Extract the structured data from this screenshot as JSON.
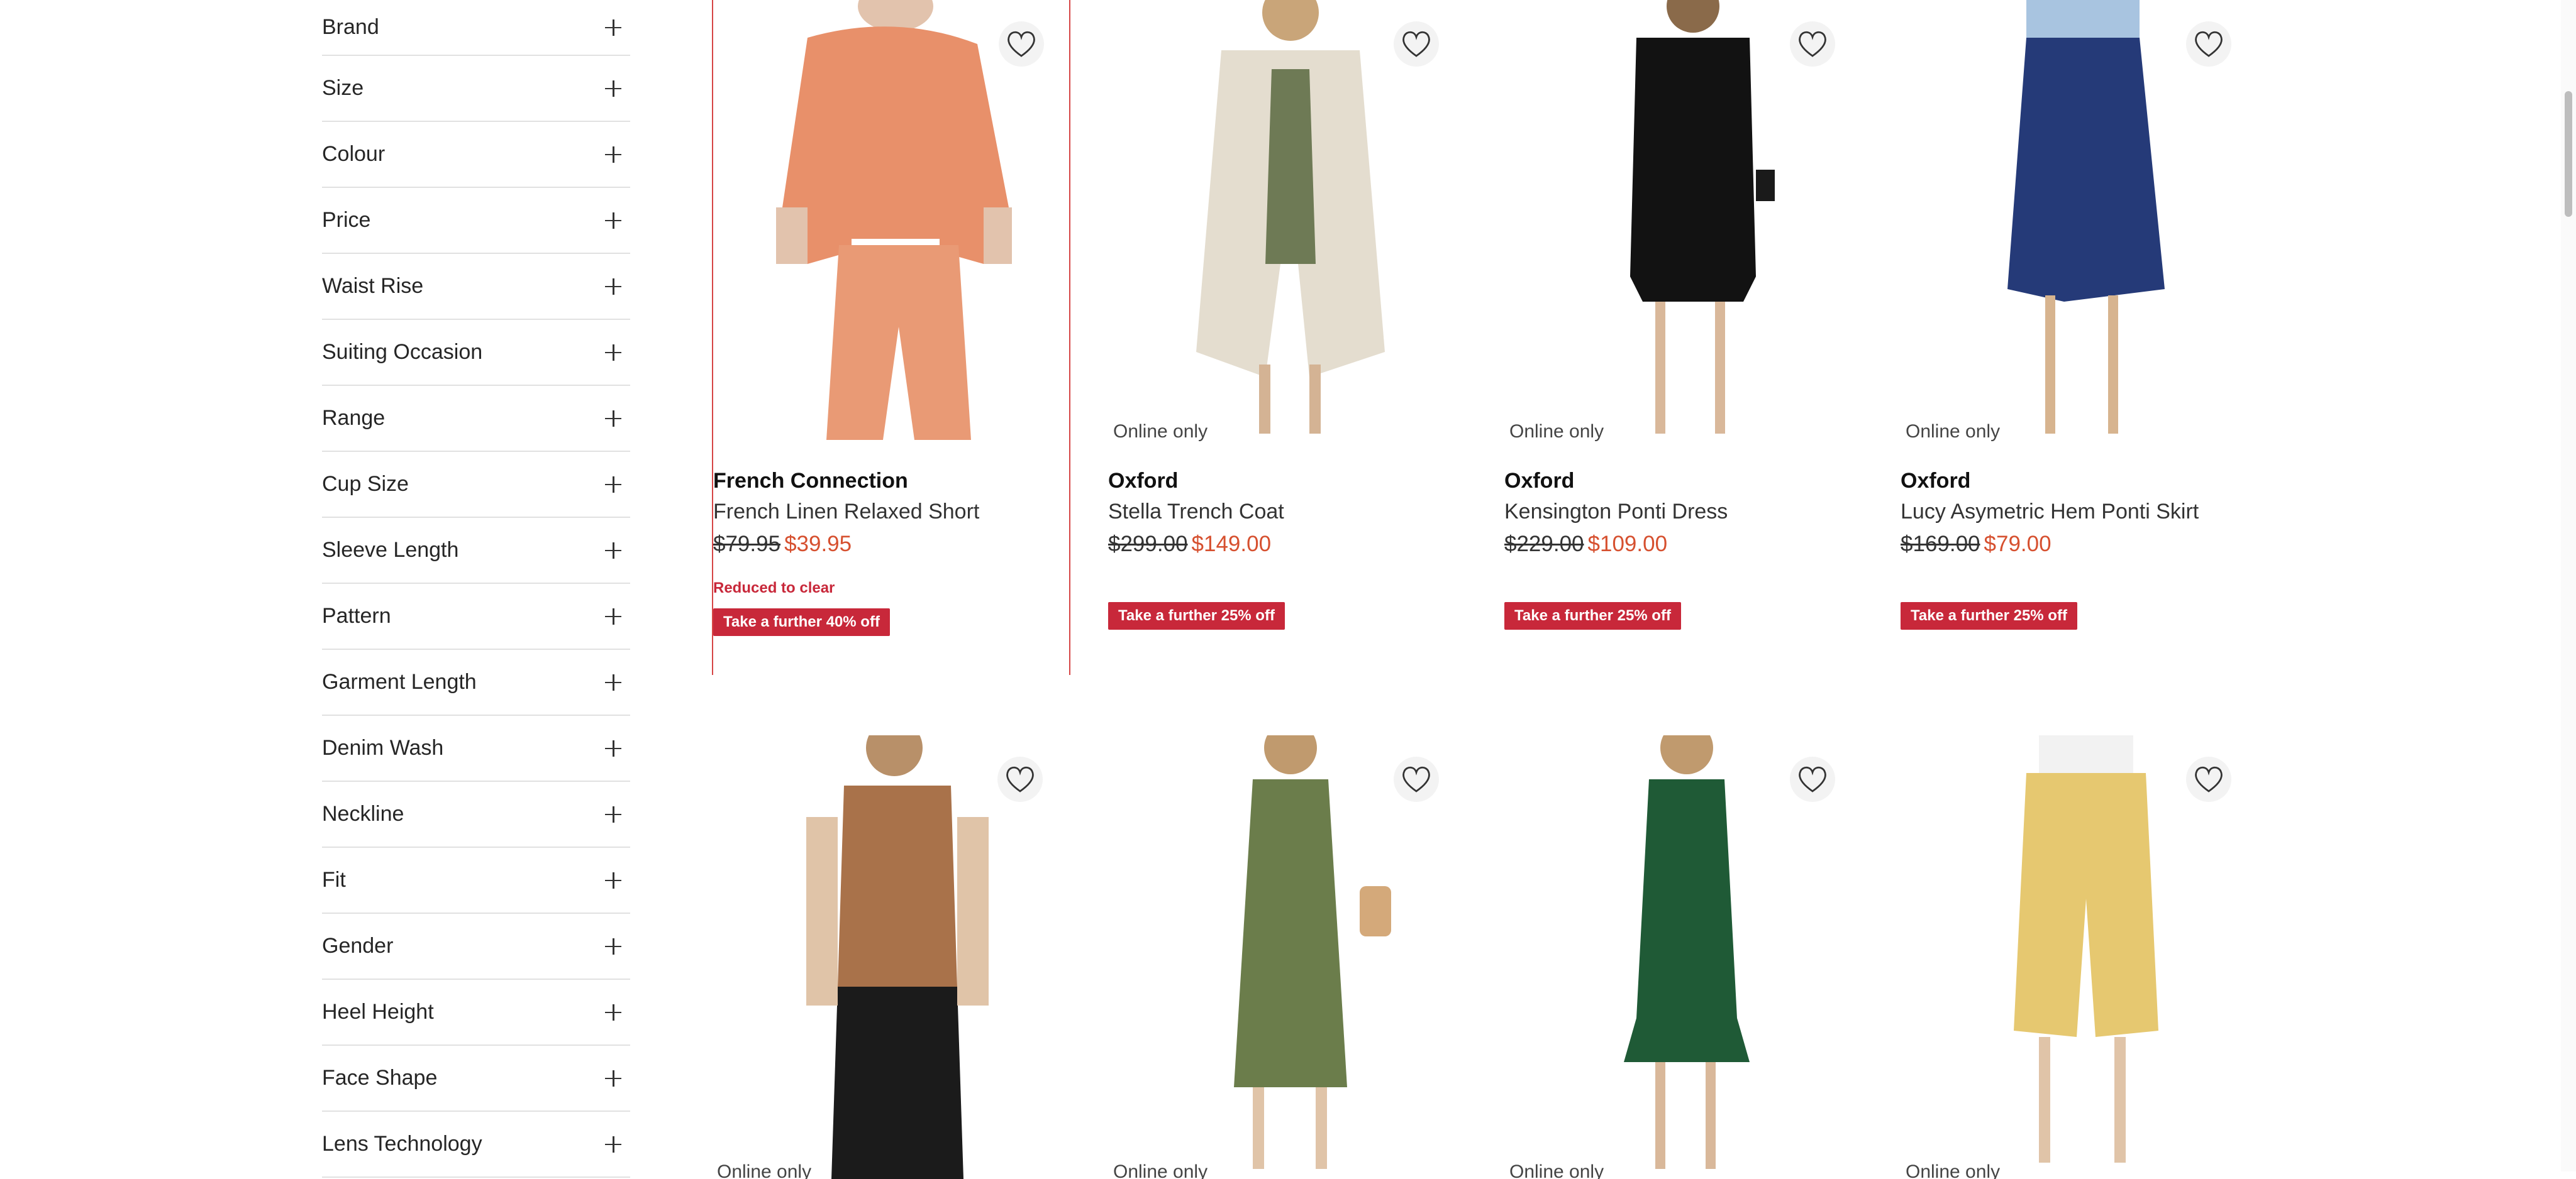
{
  "filters": [
    {
      "label": "Brand"
    },
    {
      "label": "Size"
    },
    {
      "label": "Colour"
    },
    {
      "label": "Price"
    },
    {
      "label": "Waist Rise"
    },
    {
      "label": "Suiting Occasion"
    },
    {
      "label": "Range"
    },
    {
      "label": "Cup Size"
    },
    {
      "label": "Sleeve Length"
    },
    {
      "label": "Pattern"
    },
    {
      "label": "Garment Length"
    },
    {
      "label": "Denim Wash"
    },
    {
      "label": "Neckline"
    },
    {
      "label": "Fit"
    },
    {
      "label": "Gender"
    },
    {
      "label": "Heel Height"
    },
    {
      "label": "Face Shape"
    },
    {
      "label": "Lens Technology"
    }
  ],
  "products": [
    {
      "brand": "French Connection",
      "name": "French Linen Relaxed Short",
      "was": "$79.95",
      "now": "$39.95",
      "reduced": "Reduced to clear",
      "promo": "Take a further 40% off",
      "online": ""
    },
    {
      "brand": "Oxford",
      "name": "Stella Trench Coat",
      "was": "$299.00",
      "now": "$149.00",
      "reduced": "",
      "promo": "Take a further 25% off",
      "online": "Online only"
    },
    {
      "brand": "Oxford",
      "name": "Kensington Ponti Dress",
      "was": "$229.00",
      "now": "$109.00",
      "reduced": "",
      "promo": "Take a further 25% off",
      "online": "Online only"
    },
    {
      "brand": "Oxford",
      "name": "Lucy Asymetric Hem Ponti Skirt",
      "was": "$169.00",
      "now": "$79.00",
      "reduced": "",
      "promo": "Take a further 25% off",
      "online": "Online only"
    },
    {
      "online": "Online only"
    },
    {
      "online": "Online only"
    },
    {
      "online": "Online only"
    },
    {
      "online": "Online only"
    }
  ],
  "colors": {
    "accent_red": "#c8283a",
    "sale_price": "#d6502f"
  }
}
